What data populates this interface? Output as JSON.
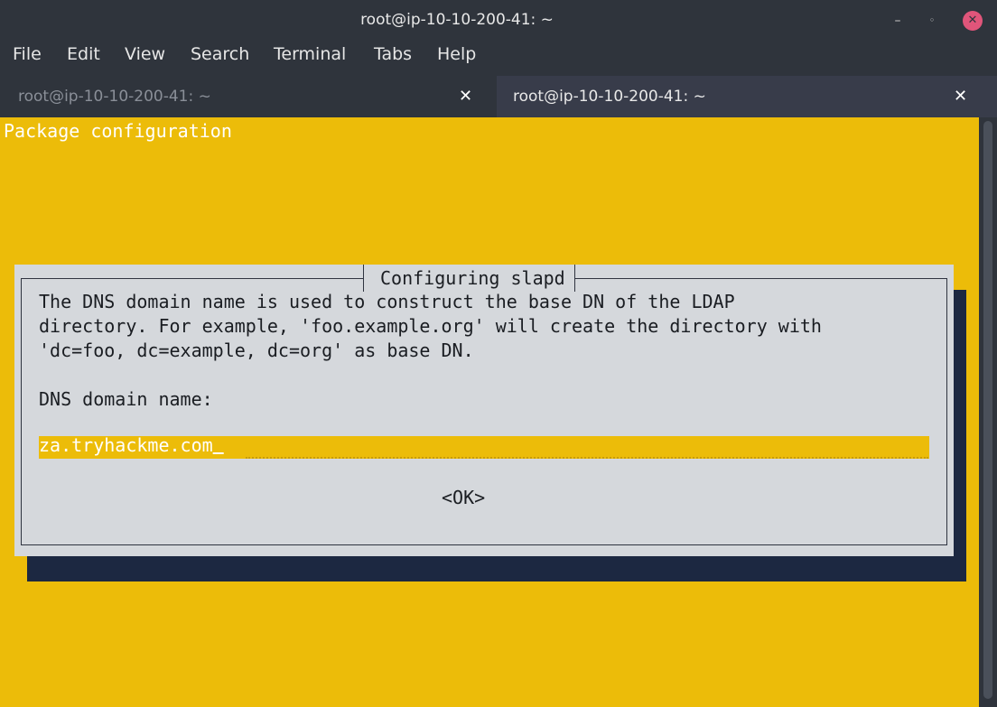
{
  "window": {
    "title": "root@ip-10-10-200-41: ~",
    "controls": {
      "minimize": "–",
      "maximize": "◦",
      "close": "✕"
    }
  },
  "menu": [
    "File",
    "Edit",
    "View",
    "Search",
    "Terminal",
    "Tabs",
    "Help"
  ],
  "tabs": [
    {
      "label": "root@ip-10-10-200-41: ~",
      "active": false,
      "close": "✕"
    },
    {
      "label": "root@ip-10-10-200-41: ~",
      "active": true,
      "close": "✕"
    }
  ],
  "terminal": {
    "header": "Package configuration",
    "background_color": "#ecbc09"
  },
  "dialog": {
    "title": "Configuring slapd",
    "description_lines": [
      "The DNS domain name is used to construct the base DN of the LDAP",
      "directory. For example, 'foo.example.org' will create the directory with",
      "'dc=foo, dc=example, dc=org' as base DN."
    ],
    "field_label": "DNS domain name:",
    "field_value": "za.tryhackme.com",
    "ok_label": "<OK>"
  }
}
